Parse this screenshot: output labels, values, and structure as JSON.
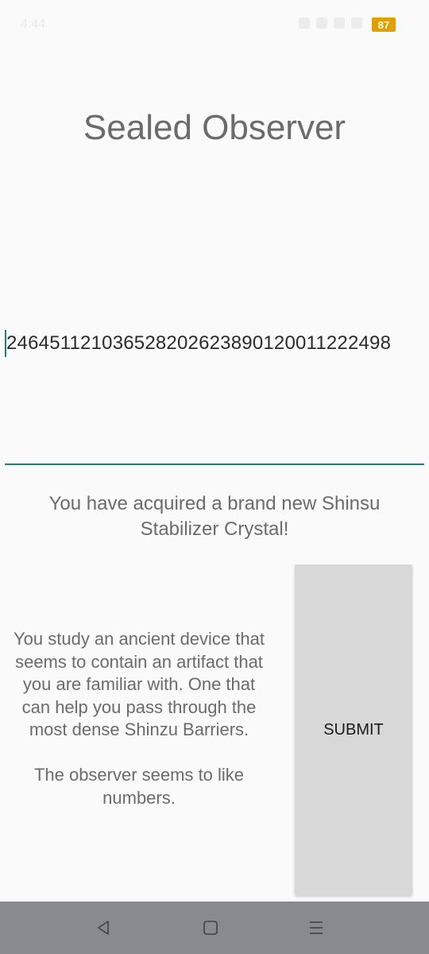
{
  "status_bar": {
    "time": "4:44",
    "battery": "87"
  },
  "title": "Sealed Observer",
  "input": {
    "value": "246451121036528202623890120011222498"
  },
  "message": "You have acquired a brand new Shinsu Stabilizer Crystal!",
  "description": {
    "paragraph1": "You study an ancient device that seems to contain an artifact that you are familiar with. One that can help you pass through the most dense Shinzu Barriers.",
    "paragraph2": "The observer seems to like numbers."
  },
  "submit_label": "SUBMIT",
  "nav": {
    "back_icon": "back-triangle-icon",
    "home_icon": "home-square-icon",
    "recents_icon": "menu-lines-icon"
  }
}
